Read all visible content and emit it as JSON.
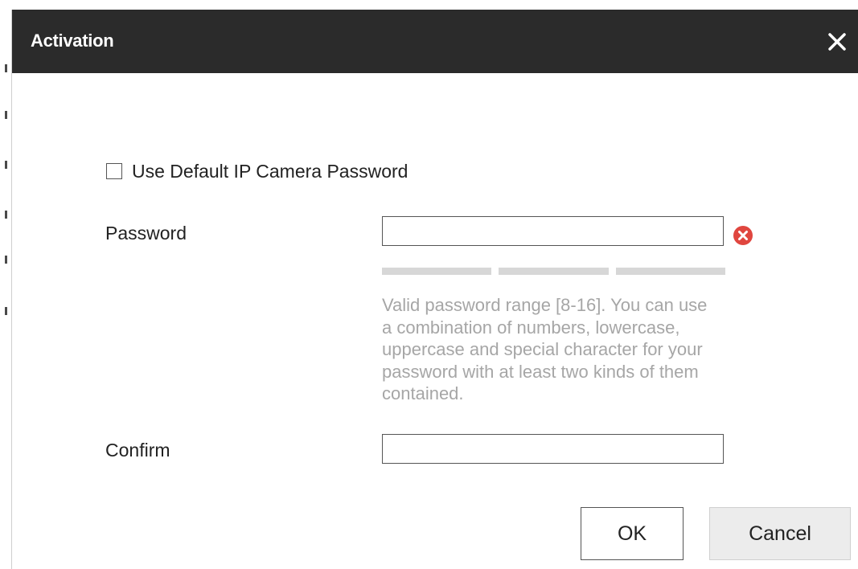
{
  "dialog": {
    "title": "Activation",
    "close_icon": "close-icon"
  },
  "default_password_option": {
    "label": "Use Default IP Camera Password",
    "checked": false
  },
  "password": {
    "label": "Password",
    "value": "",
    "status_icon": "error-icon",
    "strength_level": 0,
    "hint": "Valid password range [8-16]. You can use a combination of numbers, lowercase, uppercase and special character for your password with at least two kinds of them contained."
  },
  "confirm": {
    "label": "Confirm",
    "value": ""
  },
  "buttons": {
    "ok": "OK",
    "cancel": "Cancel"
  },
  "colors": {
    "titlebar": "#2b2b2b",
    "error": "#e0463f",
    "hint_text": "#a6a6a6",
    "strength_bar_empty": "#d7d7d7"
  }
}
